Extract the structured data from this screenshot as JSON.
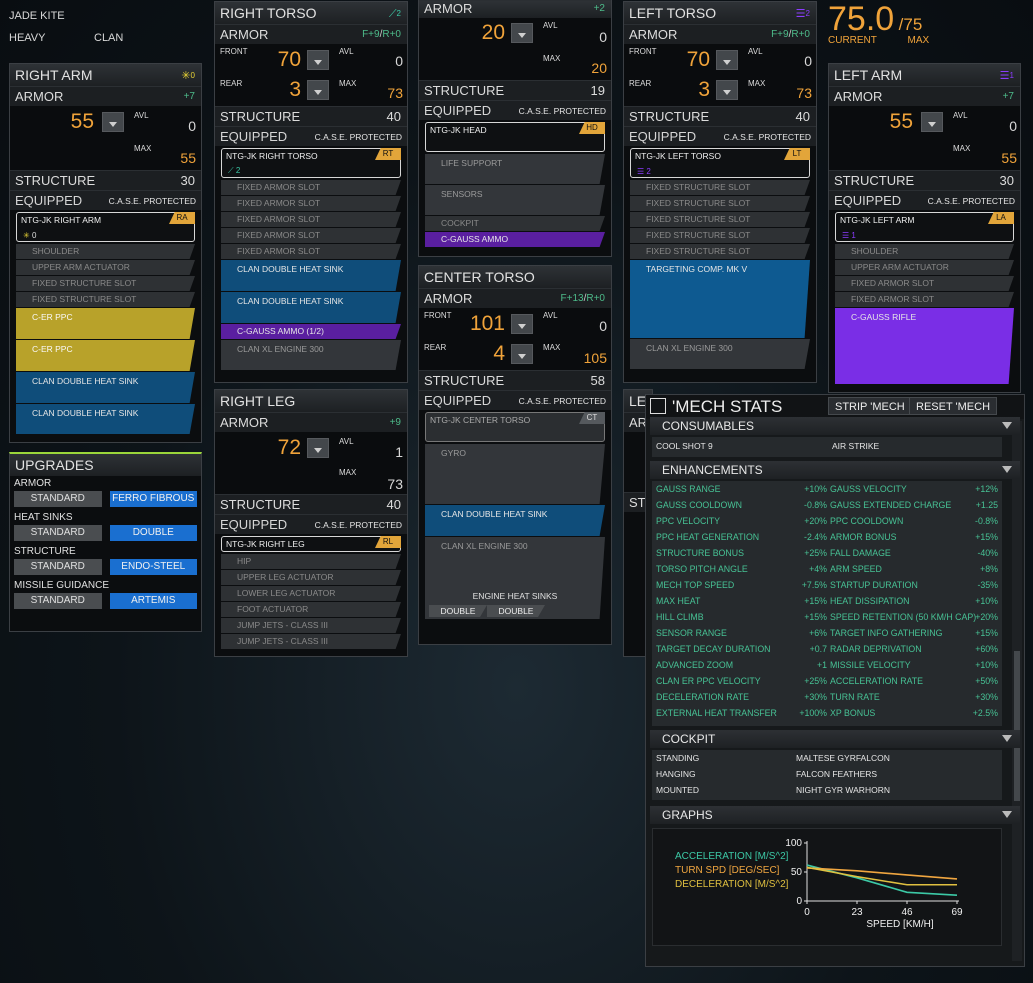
{
  "mech": {
    "name": "JADE KITE",
    "class": "HEAVY",
    "tech": "CLAN"
  },
  "tonnage": {
    "current": "75.0",
    "max": "/75",
    "current_label": "CURRENT",
    "max_label": "MAX"
  },
  "labels": {
    "armor": "ARMOR",
    "structure": "STRUCTURE",
    "equipped": "EQUIPPED",
    "case": "C.A.S.E. PROTECTED",
    "avl": "AVL",
    "max": "MAX",
    "front": "FRONT",
    "rear": "REAR"
  },
  "right_arm": {
    "title": "RIGHT ARM",
    "icon_count": "0",
    "armor_bonus": "+7",
    "armor": "55",
    "avl": "0",
    "max": "55",
    "structure": "30",
    "header_item": "NTG-JK RIGHT ARM",
    "tag": "RA",
    "header_sub": "0",
    "slots": [
      "SHOULDER",
      "UPPER ARM ACTUATOR",
      "FIXED STRUCTURE SLOT",
      "FIXED STRUCTURE SLOT"
    ],
    "weapons": [
      "C-ER PPC",
      "C-ER PPC",
      "CLAN DOUBLE HEAT SINK",
      "CLAN DOUBLE HEAT SINK"
    ]
  },
  "upgrades": {
    "title": "UPGRADES",
    "rows": [
      {
        "label": "ARMOR",
        "left": "STANDARD",
        "right": "FERRO FIBROUS"
      },
      {
        "label": "HEAT SINKS",
        "left": "STANDARD",
        "right": "DOUBLE"
      },
      {
        "label": "STRUCTURE",
        "left": "STANDARD",
        "right": "ENDO-STEEL"
      },
      {
        "label": "MISSILE GUIDANCE",
        "left": "STANDARD",
        "right": "ARTEMIS"
      }
    ]
  },
  "right_torso": {
    "title": "RIGHT TORSO",
    "icon_count": "2",
    "armor_bonus_f": "F+9",
    "armor_bonus_r": "R+0",
    "front": "70",
    "front_avl": "0",
    "rear": "3",
    "max": "73",
    "structure": "40",
    "header_item": "NTG-JK RIGHT TORSO",
    "tag": "RT",
    "header_sub": "2",
    "slots": [
      "FIXED ARMOR SLOT",
      "FIXED ARMOR SLOT",
      "FIXED ARMOR SLOT",
      "FIXED ARMOR SLOT",
      "FIXED ARMOR SLOT"
    ],
    "hs1": "CLAN DOUBLE HEAT SINK",
    "hs2": "CLAN DOUBLE HEAT SINK",
    "ammo": "C-GAUSS AMMO (1/2)",
    "engine": "CLAN XL ENGINE 300"
  },
  "right_leg": {
    "title": "RIGHT LEG",
    "armor_bonus": "+9",
    "armor": "72",
    "avl": "1",
    "max": "73",
    "structure": "40",
    "header_item": "NTG-JK RIGHT LEG",
    "tag": "RL",
    "slots": [
      "HIP",
      "UPPER LEG ACTUATOR",
      "LOWER LEG ACTUATOR",
      "FOOT ACTUATOR",
      "JUMP JETS - CLASS III",
      "JUMP JETS - CLASS III"
    ]
  },
  "head": {
    "title": "ARMOR",
    "armor_bonus": "+2",
    "armor": "20",
    "avl": "0",
    "max": "20",
    "structure": "19",
    "header_item": "NTG-JK HEAD",
    "tag": "HD",
    "slots": [
      "LIFE SUPPORT",
      "SENSORS",
      "COCKPIT"
    ],
    "ammo": "C-GAUSS AMMO"
  },
  "center_torso": {
    "title": "CENTER TORSO",
    "armor_bonus_f": "F+13",
    "armor_bonus_r": "R+0",
    "front": "101",
    "front_avl": "0",
    "rear": "4",
    "max": "105",
    "structure": "58",
    "header_item": "NTG-JK CENTER TORSO",
    "tag": "CT",
    "gyro": "GYRO",
    "hs": "CLAN DOUBLE HEAT SINK",
    "engine": "CLAN XL ENGINE 300",
    "engine_hs_label": "ENGINE HEAT SINKS",
    "engine_hs": [
      "DOUBLE",
      "DOUBLE"
    ]
  },
  "left_torso": {
    "title": "LEFT TORSO",
    "icon_count": "2",
    "armor_bonus_f": "F+9",
    "armor_bonus_r": "R+0",
    "front": "70",
    "front_avl": "0",
    "rear": "3",
    "max": "73",
    "structure": "40",
    "header_item": "NTG-JK LEFT TORSO",
    "tag": "LT",
    "header_sub": "2",
    "slots": [
      "FIXED STRUCTURE SLOT",
      "FIXED STRUCTURE SLOT",
      "FIXED STRUCTURE SLOT",
      "FIXED STRUCTURE SLOT",
      "FIXED STRUCTURE SLOT"
    ],
    "tc": "TARGETING COMP. MK V",
    "engine": "CLAN XL ENGINE 300"
  },
  "left_leg_stub": {
    "title": "LE",
    "armor": "AR",
    "structure": "STI"
  },
  "left_arm": {
    "title": "LEFT ARM",
    "icon_count": "1",
    "armor_bonus": "+7",
    "armor": "55",
    "avl": "0",
    "max": "55",
    "structure": "30",
    "header_item": "NTG-JK LEFT ARM",
    "tag": "LA",
    "header_sub": "1",
    "slots": [
      "SHOULDER",
      "UPPER ARM ACTUATOR",
      "FIXED ARMOR SLOT",
      "FIXED ARMOR SLOT"
    ],
    "weapon": "C-GAUSS RIFLE"
  },
  "mech_stats": {
    "title": "'MECH STATS",
    "strip": "STRIP 'MECH",
    "reset": "RESET 'MECH",
    "consumables": {
      "title": "CONSUMABLES",
      "items": [
        "COOL SHOT 9",
        "AIR STRIKE"
      ]
    },
    "enhancements": {
      "title": "ENHANCEMENTS",
      "left": [
        [
          "GAUSS RANGE",
          "+10%"
        ],
        [
          "GAUSS COOLDOWN",
          "-0.8%"
        ],
        [
          "PPC VELOCITY",
          "+20%"
        ],
        [
          "PPC HEAT GENERATION",
          "-2.4%"
        ],
        [
          "STRUCTURE BONUS",
          "+25%"
        ],
        [
          "TORSO PITCH ANGLE",
          "+4%"
        ],
        [
          "MECH TOP SPEED",
          "+7.5%"
        ],
        [
          "MAX HEAT",
          "+15%"
        ],
        [
          "HILL CLIMB",
          "+15%"
        ],
        [
          "SENSOR RANGE",
          "+6%"
        ],
        [
          "TARGET DECAY DURATION",
          "+0.7"
        ],
        [
          "ADVANCED ZOOM",
          "+1"
        ],
        [
          "CLAN ER PPC VELOCITY",
          "+25%"
        ],
        [
          "DECELERATION RATE",
          "+30%"
        ],
        [
          "EXTERNAL HEAT TRANSFER",
          "+100%"
        ]
      ],
      "right": [
        [
          "GAUSS VELOCITY",
          "+12%"
        ],
        [
          "GAUSS EXTENDED CHARGE",
          "+1.25"
        ],
        [
          "PPC COOLDOWN",
          "-0.8%"
        ],
        [
          "ARMOR BONUS",
          "+15%"
        ],
        [
          "FALL DAMAGE",
          "-40%"
        ],
        [
          "ARM SPEED",
          "+8%"
        ],
        [
          "STARTUP DURATION",
          "-35%"
        ],
        [
          "HEAT DISSIPATION",
          "+10%"
        ],
        [
          "SPEED RETENTION (50 KM/H CAP)",
          "+20%"
        ],
        [
          "TARGET INFO GATHERING",
          "+15%"
        ],
        [
          "RADAR DEPRIVATION",
          "+60%"
        ],
        [
          "MISSILE VELOCITY",
          "+10%"
        ],
        [
          "ACCELERATION RATE",
          "+50%"
        ],
        [
          "TURN RATE",
          "+30%"
        ],
        [
          "XP BONUS",
          "+2.5%"
        ]
      ]
    },
    "cockpit": {
      "title": "COCKPIT",
      "rows": [
        [
          "STANDING",
          "MALTESE GYRFALCON"
        ],
        [
          "HANGING",
          "FALCON FEATHERS"
        ],
        [
          "MOUNTED",
          "NIGHT GYR WARHORN"
        ]
      ]
    },
    "graphs_title": "GRAPHS"
  },
  "colors": {
    "accel": "#3cc9a6",
    "turn": "#f0a640",
    "decel": "#e0c040"
  },
  "chart_data": {
    "type": "line",
    "xlabel": "SPEED [KM/H]",
    "xlim": [
      0,
      69
    ],
    "ylim": [
      0,
      100
    ],
    "x_ticks": [
      "0",
      "23",
      "46",
      "69"
    ],
    "y_ticks": [
      "100",
      "50",
      "0"
    ],
    "series": [
      {
        "name": "ACCELERATION [M/S^2]",
        "x": [
          0,
          23,
          46,
          69
        ],
        "y": [
          62,
          40,
          15,
          10
        ]
      },
      {
        "name": "TURN SPD [DEG/SEC]",
        "x": [
          0,
          23,
          46,
          69
        ],
        "y": [
          57,
          52,
          45,
          38
        ]
      },
      {
        "name": "DECELERATION [M/S^2]",
        "x": [
          0,
          23,
          46,
          69
        ],
        "y": [
          58,
          42,
          28,
          28
        ]
      }
    ]
  }
}
